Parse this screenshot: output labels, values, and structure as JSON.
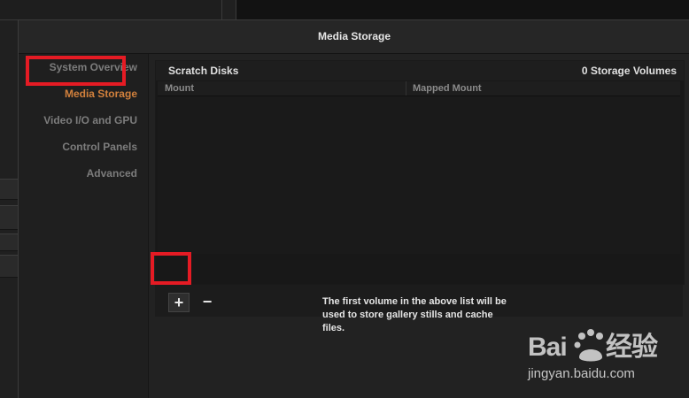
{
  "dialog": {
    "title": "Media Storage"
  },
  "sidebar": {
    "items": [
      {
        "label": "System Overview",
        "active": false
      },
      {
        "label": "Media Storage",
        "active": true
      },
      {
        "label": "Video I/O and GPU",
        "active": false
      },
      {
        "label": "Control Panels",
        "active": false
      },
      {
        "label": "Advanced",
        "active": false
      }
    ]
  },
  "scratch": {
    "title": "Scratch Disks",
    "volumes": "0 Storage Volumes",
    "columns": [
      "Mount",
      "Mapped Mount"
    ],
    "rows": []
  },
  "toolbar": {
    "add_label": "+",
    "remove_label": "−"
  },
  "info": {
    "text": "The first volume in the above list will be used to store gallery stills and cache files."
  },
  "watermark": {
    "logo_text": "Bai du 经验",
    "url": "jingyan.baidu.com"
  },
  "colors": {
    "active": "#d2803c",
    "highlight": "#e51b24"
  }
}
